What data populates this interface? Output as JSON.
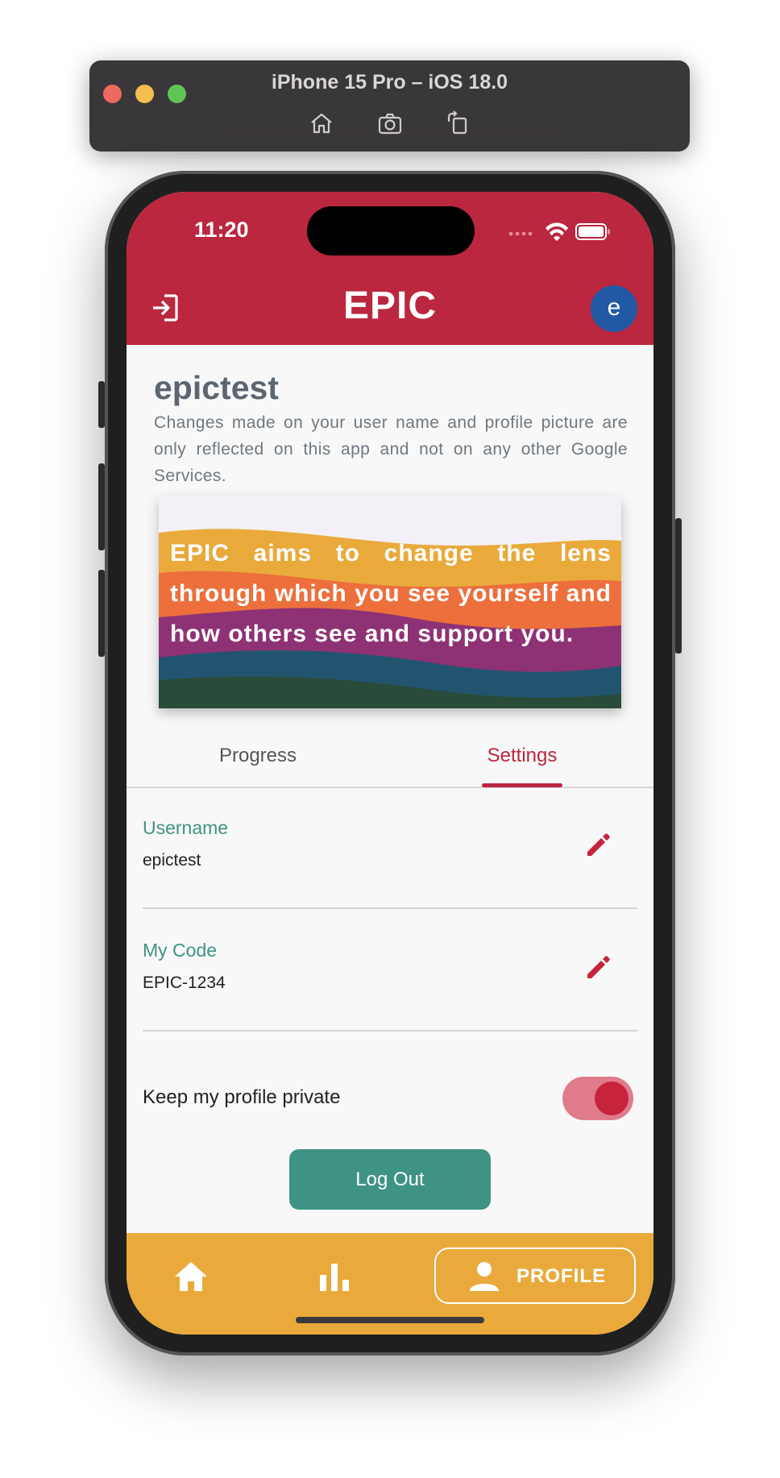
{
  "simulator": {
    "title": "iPhone 15 Pro – iOS 18.0",
    "tools": [
      "home-icon",
      "screenshot-icon",
      "rotate-icon"
    ]
  },
  "status_bar": {
    "time": "11:20"
  },
  "app_bar": {
    "title": "EPIC",
    "avatar_letter": "e"
  },
  "profile": {
    "username_title": "epictest",
    "description": "Changes made on your user name and profile picture are only reflected on this app and not on any other Google Services."
  },
  "banner": {
    "text": "EPIC aims to change the lens through which you see yourself and how others see and support you."
  },
  "tabs": [
    {
      "label": "Progress",
      "active": false
    },
    {
      "label": "Settings",
      "active": true
    }
  ],
  "settings": {
    "username": {
      "label": "Username",
      "value": "epictest"
    },
    "my_code": {
      "label": "My Code",
      "value": "EPIC-1234"
    },
    "private_toggle": {
      "label": "Keep my profile private",
      "on": true
    },
    "logout_label": "Log Out"
  },
  "bottom_nav": {
    "items": [
      "home-icon",
      "bar-chart-icon",
      "person-icon"
    ],
    "profile_label": "PROFILE"
  },
  "colors": {
    "primary": "#bb273e",
    "teal": "#3f9384",
    "nav": "#e9aa3b",
    "avatar": "#2358a5"
  }
}
